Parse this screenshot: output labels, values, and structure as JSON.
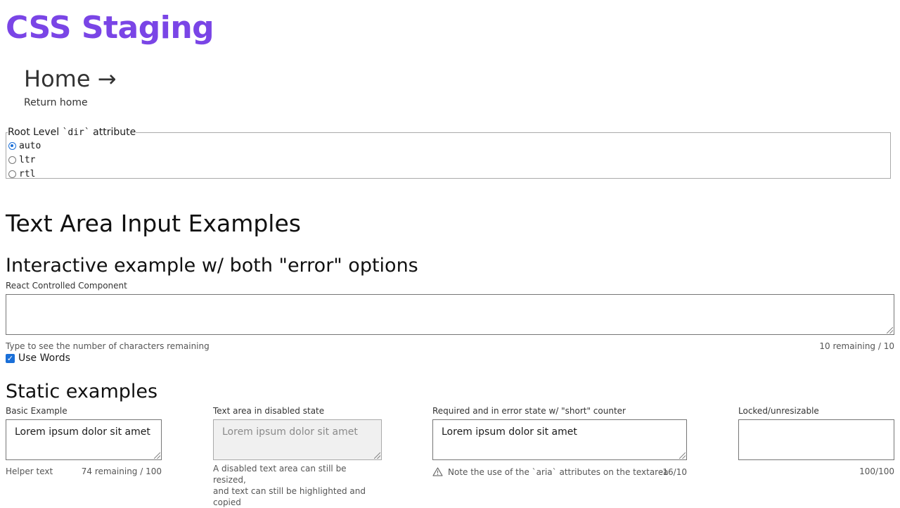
{
  "site": {
    "title": "CSS Staging"
  },
  "home": {
    "title": "Home →",
    "subtitle": "Return home"
  },
  "dir_fieldset": {
    "legend_prefix": "Root Level ",
    "legend_code": "`dir`",
    "legend_suffix": " attribute",
    "options": [
      {
        "label": "auto",
        "checked": true
      },
      {
        "label": "ltr",
        "checked": false
      },
      {
        "label": "rtl",
        "checked": false
      }
    ]
  },
  "page": {
    "heading": "Text Area Input Examples",
    "interactive_heading": "Interactive example w/ both \"error\" options",
    "static_heading": "Static examples"
  },
  "interactive": {
    "label": "React Controlled Component",
    "value": "",
    "helper": "Type to see the number of characters remaining",
    "counter": "10 remaining / 10",
    "use_words_label": "Use Words",
    "use_words_checked": true
  },
  "static": {
    "basic": {
      "label": "Basic Example",
      "value": "Lorem ipsum dolor sit amet",
      "helper": "Helper text",
      "counter": "74 remaining / 100"
    },
    "disabled": {
      "label": "Text area in disabled state",
      "value": "Lorem ipsum dolor sit amet",
      "helper_line1": "A disabled text area can still be resized,",
      "helper_line2": "and text can still be highlighted and",
      "helper_line3": "copied"
    },
    "error": {
      "label": "Required and in error state w/ \"short\" counter",
      "value": "Lorem ipsum dolor sit amet",
      "helper": "Note the use of the `aria` attributes on the textarea",
      "counter": "-16/10"
    },
    "locked": {
      "label": "Locked/unresizable",
      "value": "",
      "counter": "100/100"
    }
  },
  "colors": {
    "brand": "#7a45e6",
    "accent": "#1a6fd8"
  }
}
